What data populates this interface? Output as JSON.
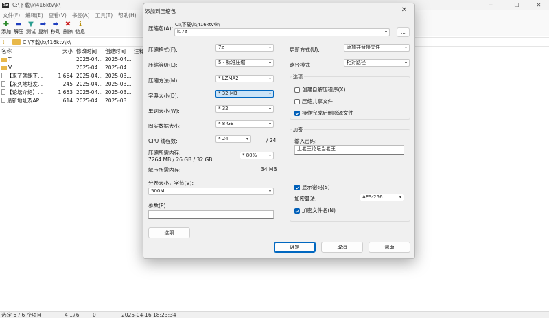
{
  "window": {
    "title": "C:\\下载\\k\\416ktv\\k\\",
    "minimize": "─",
    "maximize": "☐",
    "close": "✕"
  },
  "menu": [
    "文件(F)",
    "编辑(E)",
    "查看(V)",
    "书签(A)",
    "工具(T)",
    "帮助(H)"
  ],
  "toolbar": [
    {
      "label": "添加",
      "icon": "add-icon",
      "glyph": "✚",
      "color": "#2e8b2e"
    },
    {
      "label": "解压",
      "icon": "extract-icon",
      "glyph": "▬",
      "color": "#1f3fbf"
    },
    {
      "label": "测试",
      "icon": "test-icon",
      "glyph": "▼",
      "color": "#2a9d8f"
    },
    {
      "label": "复制",
      "icon": "copy-icon",
      "glyph": "➡",
      "color": "#1f3fbf"
    },
    {
      "label": "移动",
      "icon": "move-icon",
      "glyph": "➡",
      "color": "#1f3fbf"
    },
    {
      "label": "删除",
      "icon": "delete-icon",
      "glyph": "✖",
      "color": "#cc1f1f"
    },
    {
      "label": "信息",
      "icon": "info-icon",
      "glyph": "ℹ",
      "color": "#b58a00"
    }
  ],
  "address": {
    "path": "C:\\下载\\k\\416ktv\\k\\"
  },
  "columns": {
    "name": "名称",
    "size": "大小",
    "modified": "修改时间",
    "created": "创建时间",
    "comment": "注释"
  },
  "files": [
    {
      "name": "T",
      "size": "",
      "modified": "2025-04...",
      "created": "2025-04...",
      "type": "folder"
    },
    {
      "name": "V",
      "size": "",
      "modified": "2025-04...",
      "created": "2025-04...",
      "type": "folder"
    },
    {
      "name": "【来了就能下...",
      "size": "1 664",
      "modified": "2025-04...",
      "created": "2025-03...",
      "type": "file"
    },
    {
      "name": "【永久地址发...",
      "size": "245",
      "modified": "2025-04...",
      "created": "2025-03...",
      "type": "file"
    },
    {
      "name": "【论坛介绍】...",
      "size": "1 653",
      "modified": "2025-04...",
      "created": "2025-03...",
      "type": "file"
    },
    {
      "name": "最新地址及AP...",
      "size": "614",
      "modified": "2025-04...",
      "created": "2025-03...",
      "type": "file"
    }
  ],
  "status": {
    "selection": "选定 6 / 6 个项目",
    "total_size": "4 176",
    "selected_size": "0",
    "datetime": "2025-04-16 18:23:34"
  },
  "dialog": {
    "title": "添加到压缩包",
    "archive_label": "压缩包(A):",
    "archive_dir": "C:\\下载\\k\\416ktv\\k\\",
    "archive_name": "k.7z",
    "browse": "...",
    "format_label": "压缩格式(F):",
    "format": "7z",
    "level_label": "压缩等级(L):",
    "level": "5 - 标准压缩",
    "method_label": "压缩方法(M):",
    "method": "* LZMA2",
    "dict_label": "字典大小(D):",
    "dict": "* 32 MB",
    "word_label": "单词大小(W):",
    "word": "* 32",
    "solid_label": "固实数据大小:",
    "solid": "* 8 GB",
    "threads_label": "CPU 线程数:",
    "threads": "* 24",
    "threads_total": "/ 24",
    "mem_comp_label": "压缩所需内存:",
    "mem_comp_detail": "7264 MB / 26 GB / 32 GB",
    "mem_percent": "* 80%",
    "mem_decomp_label": "解压所需内存:",
    "mem_decomp": "34 MB",
    "split_label": "分卷大小，字节(V):",
    "split": "500M",
    "params_label": "参数(P):",
    "params": "",
    "options_button": "选项",
    "update_label": "更新方式(U):",
    "update": "添加并替换文件",
    "pathmode_label": "路径模式",
    "pathmode": "相对路径",
    "options_group": "选项",
    "opt_sfx": "创建自解压程序(X)",
    "opt_shared": "压缩共享文件",
    "opt_delete": "操作完成后删除源文件",
    "enc_group": "加密",
    "pw_label": "输入密码:",
    "password": "上老王论坛当老王",
    "show_pw": "显示密码(S)",
    "enc_method_label": "加密算法:",
    "enc_method": "AES-256",
    "enc_names": "加密文件名(N)",
    "ok": "确定",
    "cancel": "取消",
    "help": "帮助"
  }
}
